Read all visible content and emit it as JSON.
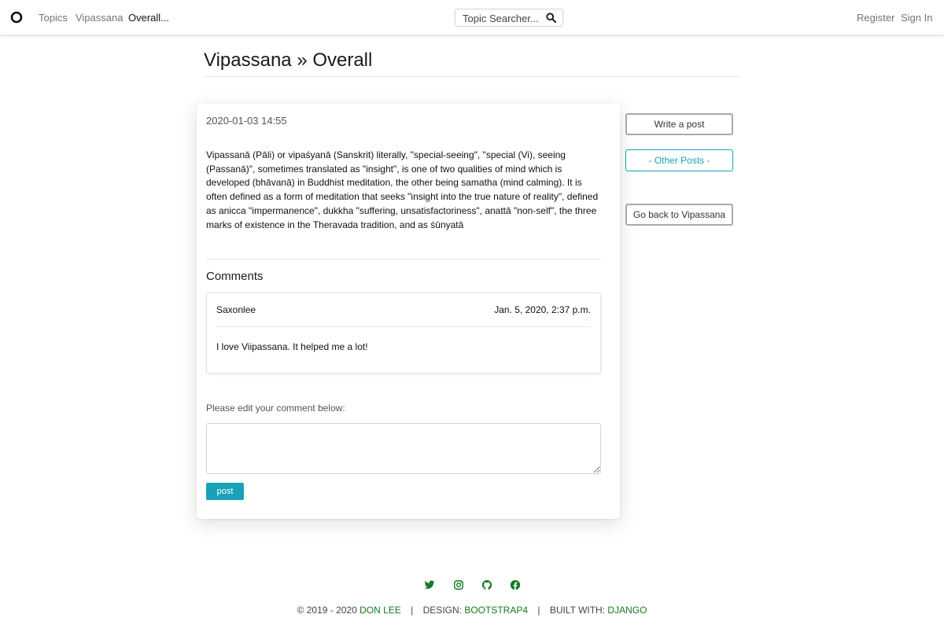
{
  "navbar": {
    "logo_icon": "ring-logo-icon",
    "links": [
      "Topics",
      "Vipassana",
      "Overall..."
    ],
    "search_placeholder": "Topic Searcher...",
    "search_icon": "search-icon",
    "register": "Register",
    "sign_in": "Sign In"
  },
  "page": {
    "title": "Vipassana » Overall"
  },
  "post": {
    "date": "2020-01-03 14:55",
    "body": "Vipassanā (Pāli) or vipaśyanā (Sanskrit) literally, \"special-seeing\", \"special (Vi), seeing (Passanā)\", sometimes translated as \"insight\", is one of two qualities of mind which is developed (bhāvanā) in Buddhist meditation, the other being samatha (mind calming). It is often defined as a form of meditation that seeks \"insight into the true nature of reality\", defined as anicca \"impermanence\", dukkha \"suffering, unsatisfactoriness\", anattā \"non-self\", the three marks of existence in the Theravada tradition, and as śūnyatā"
  },
  "comments": {
    "heading": "Comments",
    "items": [
      {
        "author": "Saxonlee",
        "time": "Jan. 5, 2020, 2:37 p.m.",
        "text": "I love Viipassana. It helped me a lot!"
      }
    ],
    "edit_label": "Please edit your comment below:",
    "textarea_value": "",
    "post_button": "post"
  },
  "sidebar": {
    "write_post": "Write a post",
    "other_posts": "- Other Posts -",
    "go_back": "Go back to Vipassana"
  },
  "footer": {
    "social_icons": [
      "twitter-icon",
      "instagram-icon",
      "github-icon",
      "facebook-icon"
    ],
    "copyright": "© 2019 - 2020",
    "author": "DON LEE",
    "design_label": "DESIGN:",
    "design_value": "BOOTSTRAP4",
    "built_label": "BUILT WITH:",
    "built_value": "DJANGO",
    "separator": "|"
  },
  "colors": {
    "info": "#17a2b8",
    "footer_link": "#157a1e",
    "nav_text": "#6c757d"
  }
}
